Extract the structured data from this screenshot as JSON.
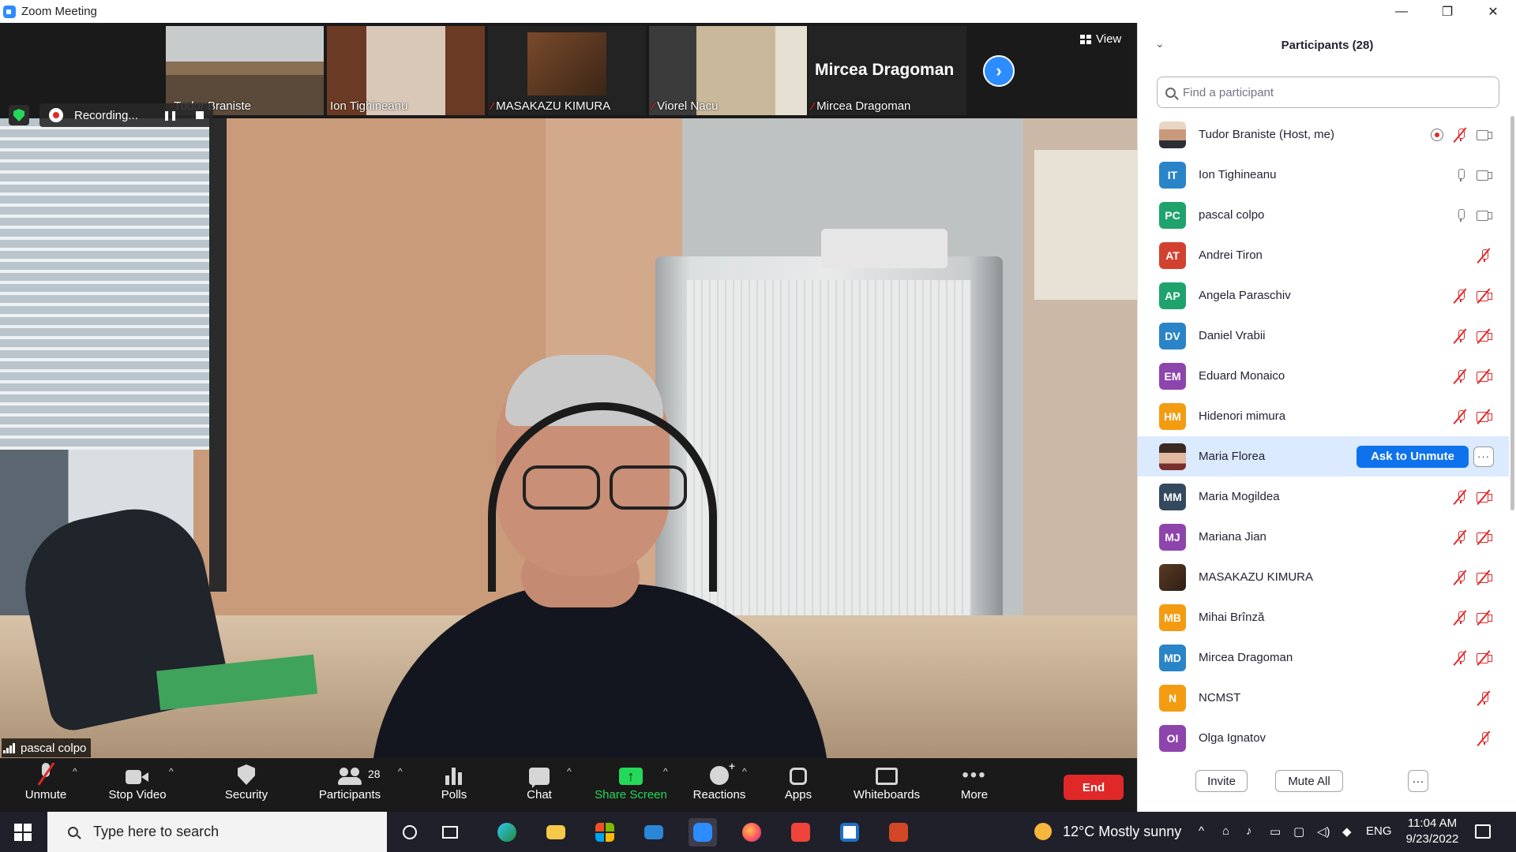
{
  "window": {
    "title": "Zoom Meeting",
    "controls": {
      "minimize": "—",
      "restore": "❐",
      "close": "✕"
    }
  },
  "gallery": {
    "thumbnails": [
      {
        "name": "Tudor Braniste",
        "muted": true
      },
      {
        "name": "Ion Tighineanu",
        "muted": false
      },
      {
        "name": "MASAKAZU KIMURA",
        "muted": true
      },
      {
        "name": "Viorel Nacu",
        "muted": true
      },
      {
        "name": "Mircea Dragoman",
        "muted": true,
        "display_name": "Mircea Dragoman"
      }
    ],
    "next_icon": "chevron-right-icon",
    "view_label": "View"
  },
  "recording": {
    "label": "Recording..."
  },
  "active_speaker": {
    "name": "pascal colpo"
  },
  "toolbar": {
    "unmute": "Unmute",
    "stop_video": "Stop Video",
    "security": "Security",
    "participants": "Participants",
    "participants_count": "28",
    "polls": "Polls",
    "chat": "Chat",
    "share_screen": "Share Screen",
    "reactions": "Reactions",
    "apps": "Apps",
    "whiteboards": "Whiteboards",
    "more": "More",
    "end": "End",
    "share_color": "#23d959",
    "end_color": "#e02828"
  },
  "panel": {
    "title": "Participants (28)",
    "search_placeholder": "Find a participant",
    "participants": [
      {
        "initials": "",
        "name": "Tudor Braniste (Host, me)",
        "color": "",
        "avatar": "photo",
        "mic": "off",
        "cam": "on",
        "rec": true
      },
      {
        "initials": "IT",
        "name": "Ion Tighineanu",
        "color": "#2a84c8",
        "mic": "on",
        "cam": "on"
      },
      {
        "initials": "PC",
        "name": "pascal colpo",
        "color": "#1ea36c",
        "mic": "on",
        "cam": "on"
      },
      {
        "initials": "AT",
        "name": "Andrei Tiron",
        "color": "#d2412f",
        "mic": "off",
        "cam": "none"
      },
      {
        "initials": "AP",
        "name": "Angela Paraschiv",
        "color": "#1ea36c",
        "mic": "off",
        "cam": "off"
      },
      {
        "initials": "DV",
        "name": "Daniel Vrabii",
        "color": "#2a84c8",
        "mic": "off",
        "cam": "off"
      },
      {
        "initials": "EM",
        "name": "Eduard Monaico",
        "color": "#8e44ad",
        "mic": "off",
        "cam": "off"
      },
      {
        "initials": "HM",
        "name": "Hidenori mimura",
        "color": "#f39c12",
        "mic": "off",
        "cam": "off"
      },
      {
        "initials": "",
        "name": "Maria Florea",
        "color": "",
        "avatar": "photo-f",
        "mic": "off",
        "cam": "off",
        "highlight": true
      },
      {
        "initials": "MM",
        "name": "Maria Mogildea",
        "color": "#34495e",
        "mic": "off",
        "cam": "off"
      },
      {
        "initials": "MJ",
        "name": "Mariana Jian",
        "color": "#8e44ad",
        "mic": "off",
        "cam": "off"
      },
      {
        "initials": "",
        "name": "MASAKAZU KIMURA",
        "color": "",
        "avatar": "photo-dark",
        "mic": "off",
        "cam": "off"
      },
      {
        "initials": "MB",
        "name": "Mihai Brînză",
        "color": "#f39c12",
        "mic": "off",
        "cam": "off"
      },
      {
        "initials": "MD",
        "name": "Mircea Dragoman",
        "color": "#2a84c8",
        "mic": "off",
        "cam": "off"
      },
      {
        "initials": "N",
        "name": "NCMST",
        "color": "#f39c12",
        "mic": "off",
        "cam": "none"
      },
      {
        "initials": "OI",
        "name": "Olga Ignatov",
        "color": "#8e44ad",
        "mic": "off",
        "cam": "none"
      }
    ],
    "ask_to_unmute": "Ask to Unmute",
    "more_dots": "···",
    "invite": "Invite",
    "mute_all": "Mute All",
    "footer_more": "···"
  },
  "taskbar": {
    "search_placeholder": "Type here to search",
    "weather": "12°C  Mostly sunny",
    "language": "ENG",
    "time": "11:04 AM",
    "date": "9/23/2022"
  }
}
